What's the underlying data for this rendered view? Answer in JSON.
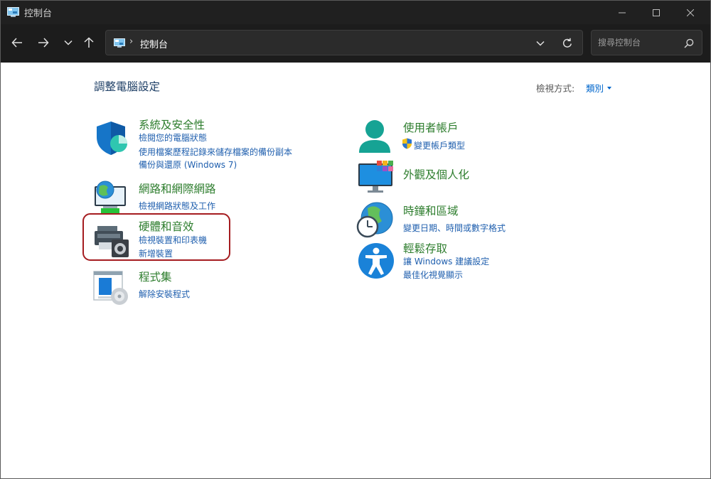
{
  "window": {
    "title": "控制台"
  },
  "toolbar": {
    "breadcrumb_separator": "›",
    "breadcrumb": "控制台",
    "search_placeholder": "搜尋控制台"
  },
  "page": {
    "heading": "調整電腦設定",
    "view_by_label": "檢視方式:",
    "view_by_value": "類別"
  },
  "categories": [
    {
      "title": "系統及安全性",
      "links": [
        "檢閱您的電腦狀態",
        "使用檔案歷程記錄來儲存檔案的備份副本",
        "備份與還原 (Windows 7)"
      ]
    },
    {
      "title": "網路和網際網路",
      "links": [
        "檢視網路狀態及工作"
      ]
    },
    {
      "title": "硬體和音效",
      "links": [
        "檢視裝置和印表機",
        "新增裝置"
      ]
    },
    {
      "title": "程式集",
      "links": [
        "解除安裝程式"
      ]
    },
    {
      "title": "使用者帳戶",
      "links": [
        "變更帳戶類型"
      ]
    },
    {
      "title": "外觀及個人化",
      "links": []
    },
    {
      "title": "時鐘和區域",
      "links": [
        "變更日期、時間或數字格式"
      ]
    },
    {
      "title": "輕鬆存取",
      "links": [
        "讓 Windows 建議設定",
        "最佳化視覺顯示"
      ]
    }
  ],
  "icons": {
    "app": "control-panel-icon",
    "back": "arrow-left-icon",
    "forward": "arrow-right-icon",
    "recent": "chevron-down-icon",
    "up": "arrow-up-icon",
    "refresh": "refresh-icon",
    "search": "search-icon",
    "minimize": "minimize-icon",
    "maximize": "maximize-icon",
    "close": "close-icon",
    "uac_shield": "uac-shield-icon"
  },
  "colors": {
    "titlebar": "#202020",
    "category_title": "#2d7d2d",
    "link": "#1f5fae",
    "heading": "#1e3f66",
    "highlight_outline": "#a51c20"
  }
}
